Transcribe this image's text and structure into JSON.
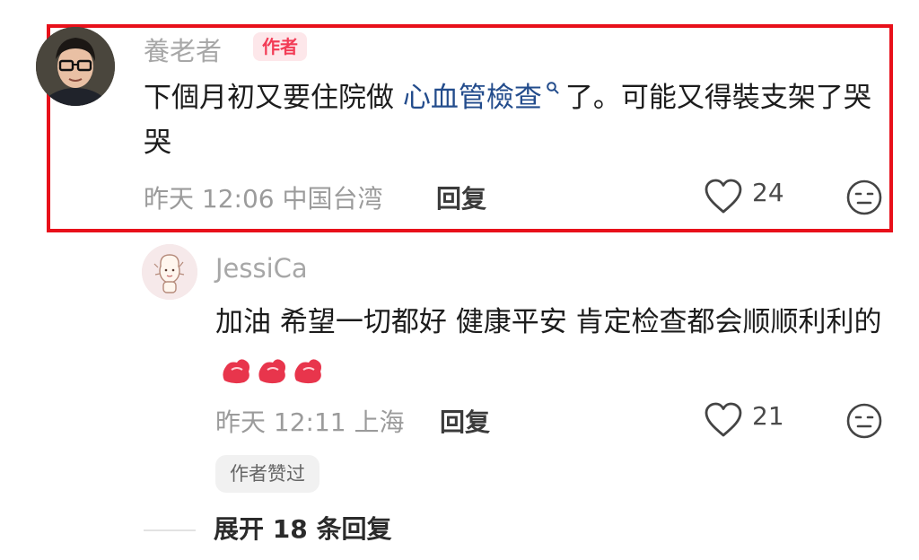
{
  "author_comment": {
    "username": "養老者",
    "badge": "作者",
    "text_before": "下個月初又要住院做",
    "link_text": "心血管檢查",
    "text_after": "了。可能又得裝支架了哭哭",
    "time": "昨天 12:06",
    "location": "中国台湾",
    "reply_label": "回复",
    "likes": "24"
  },
  "reply_comment": {
    "username": "JessiCa",
    "text": "加油 希望一切都好 健康平安 肯定检查都会顺顺利利的",
    "emoji": [
      "flexed-biceps",
      "flexed-biceps",
      "flexed-biceps"
    ],
    "time": "昨天 12:11",
    "location": "上海",
    "reply_label": "回复",
    "likes": "21",
    "author_liked_badge": "作者赞过"
  },
  "expand": {
    "label": "展开 18 条回复"
  },
  "colors": {
    "highlight": "#e8101a",
    "badge_bg": "#fde7ea",
    "badge_text": "#f23c56",
    "link": "#234c8c"
  },
  "icons": [
    "heart-outline-icon",
    "neutral-face-icon",
    "search-icon"
  ]
}
